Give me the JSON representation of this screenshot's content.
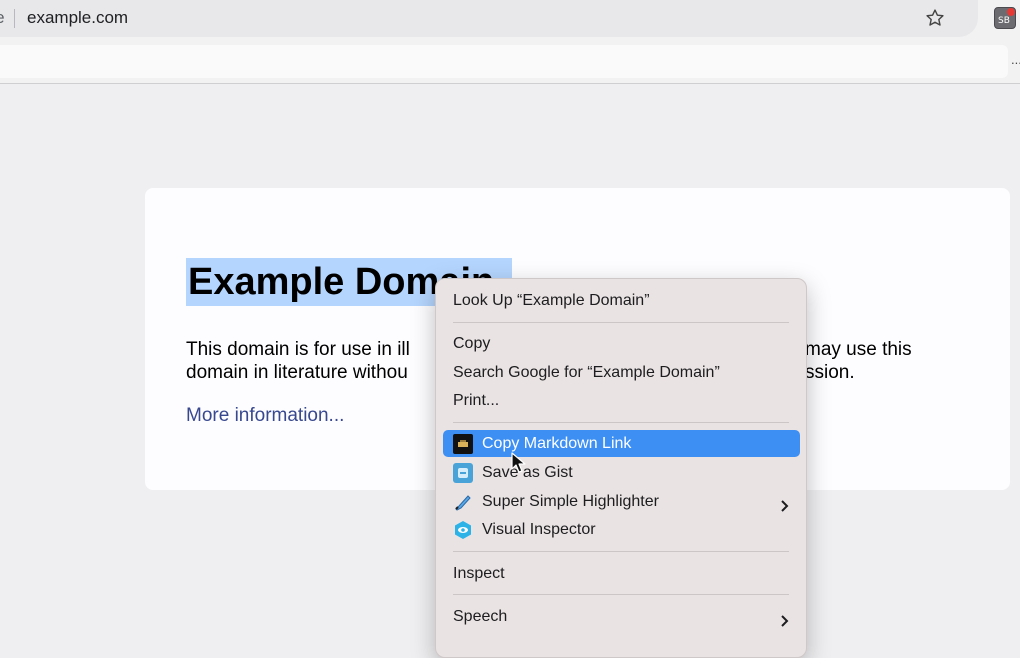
{
  "browser": {
    "scheme_fragment": "ure",
    "url": "example.com",
    "extension_badge": "SB",
    "overflow": "..."
  },
  "page": {
    "title": "Example Domain",
    "paragraph_line1_left": "This domain is for use in ill",
    "paragraph_line1_right": "may use this",
    "paragraph_line2_left": "domain in literature withou",
    "paragraph_line2_right": "ssion.",
    "link": "More information..."
  },
  "context_menu": {
    "items": [
      {
        "label": "Look Up “Example Domain”"
      },
      {
        "label": "Copy"
      },
      {
        "label": "Search Google for “Example Domain”"
      },
      {
        "label": "Print..."
      },
      {
        "label": "Copy Markdown Link",
        "icon": "markdown-icon",
        "active": true
      },
      {
        "label": "Save as Gist",
        "icon": "gist-icon"
      },
      {
        "label": "Super Simple Highlighter",
        "icon": "highlighter-icon",
        "submenu": true
      },
      {
        "label": "Visual Inspector",
        "icon": "inspector-icon"
      },
      {
        "label": "Inspect"
      },
      {
        "label": "Speech",
        "submenu": true
      }
    ]
  },
  "colors": {
    "selection": "#b4d5fe",
    "menu_highlight": "#3d8ff4",
    "link": "#38488f"
  }
}
